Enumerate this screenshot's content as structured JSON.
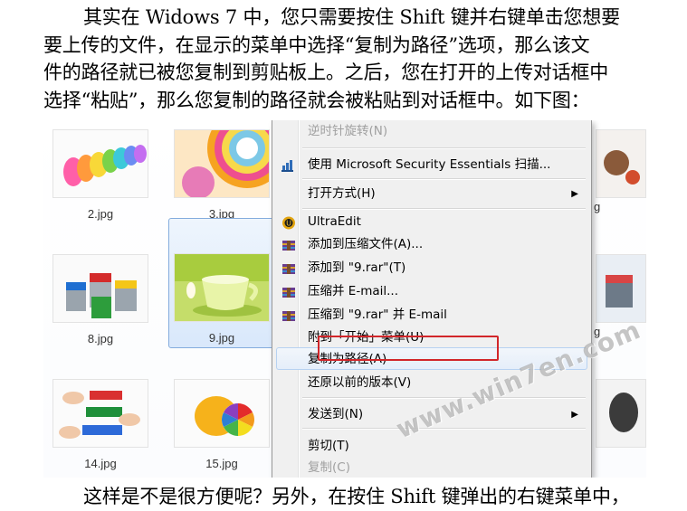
{
  "paragraph_top": {
    "lines": [
      "其实在 Widows 7 中，您只需要按住 Shift 键并右键单击您想要",
      "要上传的文件，在显示的菜单中选择“复制为路径”选项，那么该文",
      "件的路径就已被您复制到剪贴板上。之后，您在打开的上传对话框中",
      "选择“粘贴”，那么您复制的路径就会被粘贴到对话框中。如下图："
    ]
  },
  "paragraph_bottom": {
    "text": "这样是不是很方便呢？另外，在按住 Shift 键弹出的右键菜单中，"
  },
  "explorer": {
    "files": [
      {
        "name": "2.jpg"
      },
      {
        "name": "3.jpg"
      },
      {
        "name": "8.jpg"
      },
      {
        "name": "9.jpg",
        "selected": true
      },
      {
        "name": "14.jpg"
      },
      {
        "name": "15.jpg"
      }
    ],
    "right_column_captions": [
      "g",
      "g"
    ]
  },
  "context_menu": {
    "items": [
      {
        "label": "逆时针旋转(N)",
        "disabled": true
      },
      {
        "label": "使用 Microsoft Security Essentials 扫描...",
        "icon": "security-essentials-icon"
      },
      {
        "label": "打开方式(H)",
        "submenu": true
      },
      {
        "label": "UltraEdit",
        "icon": "ultraedit-icon"
      },
      {
        "label": "添加到压缩文件(A)...",
        "icon": "winrar-icon"
      },
      {
        "label": "添加到 \"9.rar\"(T)",
        "icon": "winrar-icon"
      },
      {
        "label": "压缩并 E-mail...",
        "icon": "winrar-icon"
      },
      {
        "label": "压缩到 \"9.rar\" 并 E-mail",
        "icon": "winrar-icon"
      },
      {
        "label": "附到「开始」菜单(U)"
      },
      {
        "label": "复制为路径(A)",
        "highlighted": true
      },
      {
        "label": "还原以前的版本(V)"
      },
      {
        "label": "发送到(N)",
        "submenu": true
      },
      {
        "label": "剪切(T)"
      },
      {
        "label": "复制(C)",
        "disabled": true
      }
    ]
  },
  "watermark": {
    "text": "www.win7en.com"
  },
  "colors": {
    "highlight_box": "#d2262a",
    "selection_border": "#84acdd",
    "menu_bg": "#f0f0f0"
  }
}
